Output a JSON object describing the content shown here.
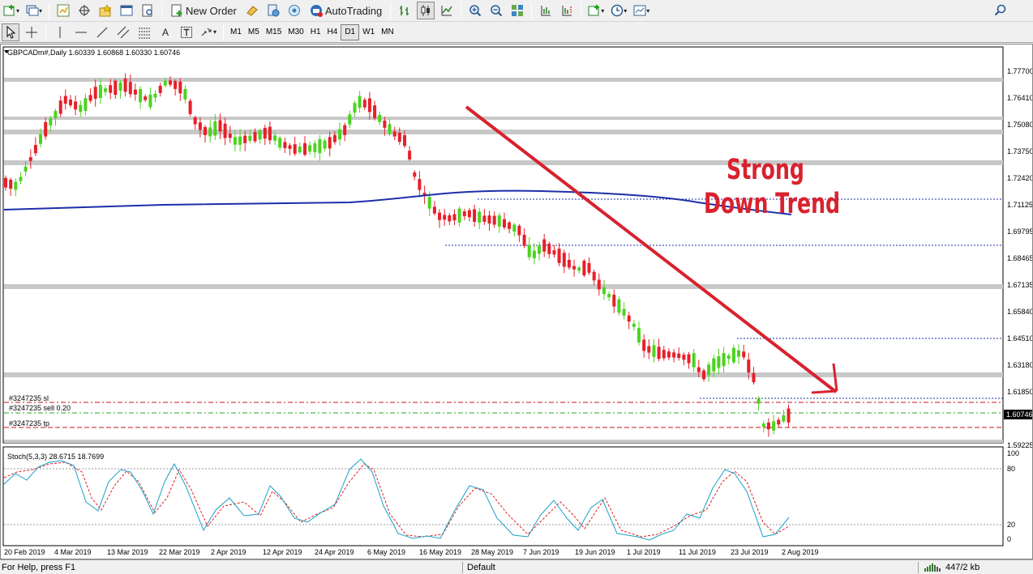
{
  "toolbar": {
    "new_order": "New Order",
    "auto_trading": "AutoTrading",
    "timeframes": [
      "M1",
      "M5",
      "M15",
      "M30",
      "H1",
      "H4",
      "D1",
      "W1",
      "MN"
    ],
    "active_timeframe": "D1",
    "icons": [
      "new-chart-icon",
      "profiles-icon",
      "market-watch-icon",
      "navigator-icon",
      "favorites-icon",
      "terminal-icon",
      "strategy-tester-icon",
      "metaeditor-icon",
      "signals-icon",
      "bar-chart-icon",
      "candlestick-icon",
      "line-chart-icon",
      "zoom-in-icon",
      "zoom-out-icon",
      "tile-windows-icon",
      "autoscroll-icon",
      "chart-shift-icon",
      "indicators-icon",
      "periods-icon",
      "templates-icon",
      "search-icon",
      "cursor-icon",
      "crosshair-icon",
      "vertical-line-icon",
      "horizontal-line-icon",
      "trendline-icon",
      "channel-icon",
      "fibo-icon",
      "text-icon",
      "text-label-icon",
      "arrows-icon"
    ]
  },
  "chart": {
    "header": "GBPCADm#,Daily  1.60339 1.60868 1.60330 1.60746",
    "current_price": "1.60746",
    "price_labels": [
      "1.77700",
      "1.76410",
      "1.75080",
      "1.73750",
      "1.72420",
      "1.71125",
      "1.69795",
      "1.68465",
      "1.67135",
      "1.65840",
      "1.64510",
      "1.63180",
      "1.61850",
      "1.59225"
    ],
    "date_labels": [
      "20 Feb 2019",
      "4 Mar 2019",
      "13 Mar 2019",
      "22 Mar 2019",
      "2 Apr 2019",
      "12 Apr 2019",
      "24 Apr 2019",
      "6 May 2019",
      "16 May 2019",
      "28 May 2019",
      "7 Jun 2019",
      "19 Jun 2019",
      "1 Jul 2019",
      "11 Jul 2019",
      "23 Jul 2019",
      "2 Aug 2019"
    ],
    "annotation_line1": "Strong",
    "annotation_line2": "Down Trend",
    "order_sl": "#3247235 sl",
    "order_sell": "#3247235 sell 0.20",
    "order_tp": "#3247235 tp",
    "stoch_label": "Stoch(5,3,3) 28.6715 18.7699",
    "stoch_levels": [
      "100",
      "80",
      "20",
      "0"
    ],
    "colors": {
      "bull": "#4cd320",
      "bear": "#e6202a",
      "ma": "#1c2fa8",
      "trend_arrow": "#d8222f",
      "support_band": "#c8c8c8",
      "stoch_main": "#1aa0c8",
      "stoch_signal": "#e02020"
    }
  },
  "status": {
    "help": "For Help, press F1",
    "profile": "Default",
    "traffic": "447/2 kb"
  }
}
